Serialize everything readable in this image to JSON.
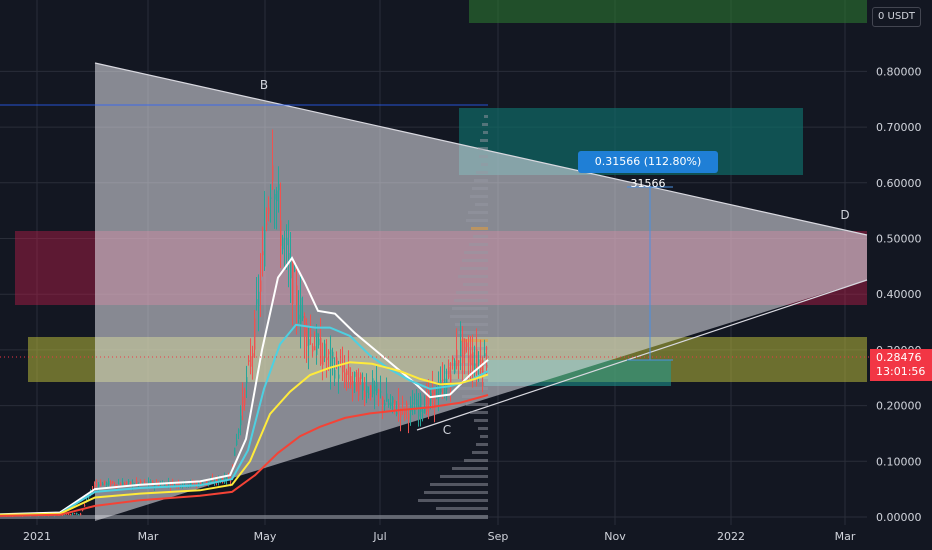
{
  "chart_data": {
    "type": "candlestick",
    "quote_currency": "USDT",
    "last_price": "0.28476",
    "countdown": "13:01:56",
    "y_ticks": [
      "0.00000",
      "0.10000",
      "0.20000",
      "0.30000",
      "0.40000",
      "0.50000",
      "0.60000",
      "0.70000",
      "0.80000"
    ],
    "x_ticks": [
      "2021",
      "Mar",
      "May",
      "Jul",
      "Sep",
      "Nov",
      "2022",
      "Mar"
    ],
    "annotations": [
      "B",
      "C",
      "D"
    ],
    "measurement": "0.31566 (112.80%) 31566",
    "moving_averages": [
      {
        "color": "#ffffff",
        "values": [
          [
            0,
            0.005
          ],
          [
            60,
            0.008
          ],
          [
            95,
            0.05
          ],
          [
            140,
            0.058
          ],
          [
            200,
            0.064
          ],
          [
            230,
            0.075
          ],
          [
            246,
            0.14
          ],
          [
            262,
            0.3
          ],
          [
            278,
            0.43
          ],
          [
            292,
            0.465
          ],
          [
            305,
            0.42
          ],
          [
            318,
            0.37
          ],
          [
            335,
            0.365
          ],
          [
            355,
            0.33
          ],
          [
            375,
            0.3
          ],
          [
            395,
            0.27
          ],
          [
            415,
            0.24
          ],
          [
            430,
            0.215
          ],
          [
            450,
            0.22
          ],
          [
            470,
            0.255
          ],
          [
            488,
            0.282
          ]
        ]
      },
      {
        "color": "#4dd0e1",
        "values": [
          [
            0,
            0.004
          ],
          [
            60,
            0.006
          ],
          [
            95,
            0.045
          ],
          [
            140,
            0.052
          ],
          [
            200,
            0.057
          ],
          [
            232,
            0.068
          ],
          [
            248,
            0.12
          ],
          [
            264,
            0.23
          ],
          [
            280,
            0.31
          ],
          [
            296,
            0.345
          ],
          [
            315,
            0.34
          ],
          [
            330,
            0.34
          ],
          [
            350,
            0.325
          ],
          [
            370,
            0.29
          ],
          [
            390,
            0.265
          ],
          [
            410,
            0.245
          ],
          [
            430,
            0.23
          ],
          [
            450,
            0.235
          ],
          [
            470,
            0.245
          ],
          [
            488,
            0.262
          ]
        ]
      },
      {
        "color": "#ffeb3b",
        "values": [
          [
            0,
            0.004
          ],
          [
            60,
            0.006
          ],
          [
            95,
            0.035
          ],
          [
            140,
            0.042
          ],
          [
            200,
            0.048
          ],
          [
            232,
            0.058
          ],
          [
            250,
            0.1
          ],
          [
            270,
            0.185
          ],
          [
            290,
            0.225
          ],
          [
            310,
            0.255
          ],
          [
            330,
            0.268
          ],
          [
            350,
            0.278
          ],
          [
            372,
            0.275
          ],
          [
            400,
            0.262
          ],
          [
            420,
            0.248
          ],
          [
            440,
            0.238
          ],
          [
            460,
            0.24
          ],
          [
            475,
            0.248
          ],
          [
            488,
            0.256
          ]
        ]
      },
      {
        "color": "#f44336",
        "values": [
          [
            0,
            0.002
          ],
          [
            60,
            0.004
          ],
          [
            95,
            0.02
          ],
          [
            140,
            0.03
          ],
          [
            200,
            0.038
          ],
          [
            232,
            0.045
          ],
          [
            255,
            0.075
          ],
          [
            278,
            0.115
          ],
          [
            300,
            0.145
          ],
          [
            320,
            0.162
          ],
          [
            345,
            0.178
          ],
          [
            370,
            0.186
          ],
          [
            400,
            0.192
          ],
          [
            430,
            0.197
          ],
          [
            460,
            0.205
          ],
          [
            488,
            0.219
          ]
        ]
      }
    ]
  }
}
